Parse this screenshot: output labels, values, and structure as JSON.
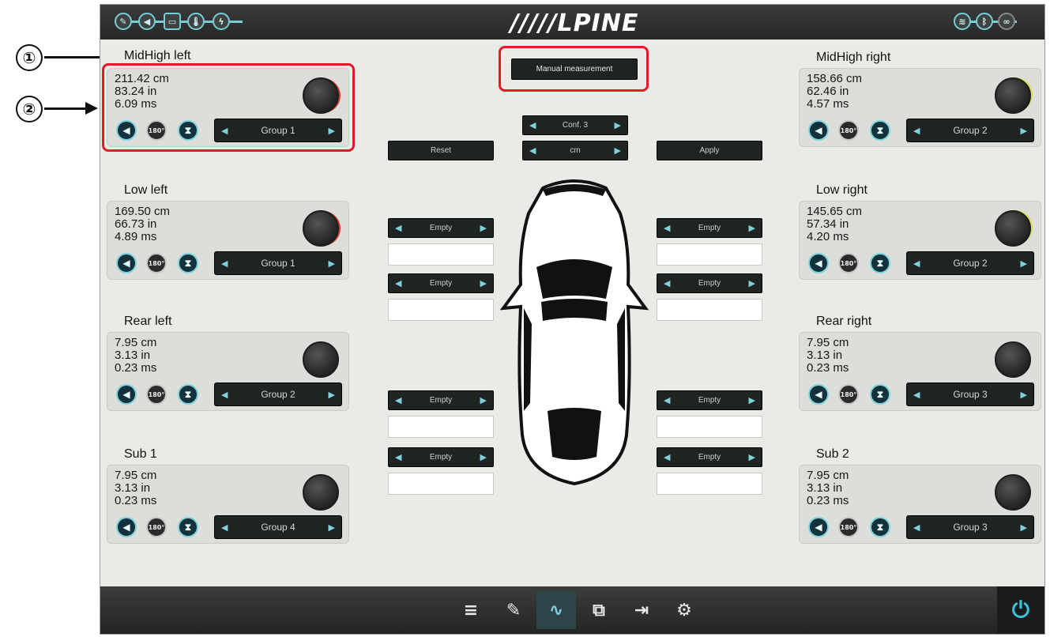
{
  "callouts": {
    "one": "①",
    "two": "②"
  },
  "header": {
    "logo": "/////LPINE",
    "left_icons": [
      "pen-icon",
      "speaker-icon",
      "battery-icon",
      "thermometer-icon",
      "bolt-icon"
    ],
    "right_icons": [
      "wifi-icon",
      "bluetooth-icon",
      "link-icon"
    ]
  },
  "manual_measurement": "Manual measurement",
  "center": {
    "conf": "Conf. 3",
    "unit": "cm",
    "reset": "Reset",
    "apply": "Apply",
    "empty": "Empty"
  },
  "speakers": {
    "midhigh_left": {
      "name": "MidHigh left",
      "cm": "211.42 cm",
      "in": "83.24 in",
      "ms": "6.09 ms",
      "group": "Group 1"
    },
    "midhigh_right": {
      "name": "MidHigh right",
      "cm": "158.66 cm",
      "in": "62.46 in",
      "ms": "4.57 ms",
      "group": "Group 2"
    },
    "low_left": {
      "name": "Low left",
      "cm": "169.50 cm",
      "in": "66.73 in",
      "ms": "4.89 ms",
      "group": "Group 1"
    },
    "low_right": {
      "name": "Low right",
      "cm": "145.65 cm",
      "in": "57.34 in",
      "ms": "4.20 ms",
      "group": "Group 2"
    },
    "rear_left": {
      "name": "Rear left",
      "cm": "7.95 cm",
      "in": "3.13 in",
      "ms": "0.23 ms",
      "group": "Group 2"
    },
    "rear_right": {
      "name": "Rear  right",
      "cm": "7.95 cm",
      "in": "3.13 in",
      "ms": "0.23 ms",
      "group": "Group 3"
    },
    "sub1": {
      "name": "Sub 1",
      "cm": "7.95 cm",
      "in": "3.13 in",
      "ms": "0.23 ms",
      "group": "Group 4"
    },
    "sub2": {
      "name": "Sub 2",
      "cm": "7.95 cm",
      "in": "3.13 in",
      "ms": "0.23 ms",
      "group": "Group 3"
    }
  },
  "controls": {
    "phase": "180°"
  },
  "bottom_nav": [
    "equalizer-icon",
    "pen-icon",
    "measure-icon",
    "copy-icon",
    "forward-icon",
    "gear-icon"
  ],
  "colors": {
    "accent": "#7fd2dd",
    "highlight": "#e21c27",
    "bar": "#262827"
  }
}
